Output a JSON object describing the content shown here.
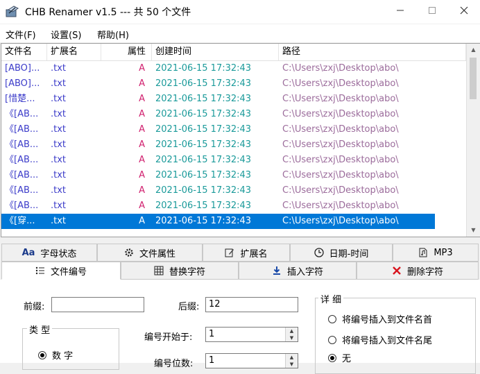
{
  "window": {
    "title": "CHB Renamer v1.5 --- 共 50 个文件"
  },
  "menu": [
    "文件(F)",
    "设置(S)",
    "帮助(H)"
  ],
  "list": {
    "columns": [
      "文件名",
      "扩展名",
      "属性",
      "创建时间",
      "路径"
    ],
    "rows": [
      {
        "name": "[ABO]...",
        "ext": ".txt",
        "attr": "A",
        "time": "2021-06-15 17:32:43",
        "path": "C:\\Users\\zxj\\Desktop\\abo\\"
      },
      {
        "name": "[ABO]...",
        "ext": ".txt",
        "attr": "A",
        "time": "2021-06-15 17:32:43",
        "path": "C:\\Users\\zxj\\Desktop\\abo\\"
      },
      {
        "name": "[惜楚...",
        "ext": ".txt",
        "attr": "A",
        "time": "2021-06-15 17:32:43",
        "path": "C:\\Users\\zxj\\Desktop\\abo\\"
      },
      {
        "name": "《[AB...",
        "ext": ".txt",
        "attr": "A",
        "time": "2021-06-15 17:32:43",
        "path": "C:\\Users\\zxj\\Desktop\\abo\\"
      },
      {
        "name": "《[AB...",
        "ext": ".txt",
        "attr": "A",
        "time": "2021-06-15 17:32:43",
        "path": "C:\\Users\\zxj\\Desktop\\abo\\"
      },
      {
        "name": "《[AB...",
        "ext": ".txt",
        "attr": "A",
        "time": "2021-06-15 17:32:43",
        "path": "C:\\Users\\zxj\\Desktop\\abo\\"
      },
      {
        "name": "《[AB...",
        "ext": ".txt",
        "attr": "A",
        "time": "2021-06-15 17:32:43",
        "path": "C:\\Users\\zxj\\Desktop\\abo\\"
      },
      {
        "name": "《[AB...",
        "ext": ".txt",
        "attr": "A",
        "time": "2021-06-15 17:32:43",
        "path": "C:\\Users\\zxj\\Desktop\\abo\\"
      },
      {
        "name": "《[AB...",
        "ext": ".txt",
        "attr": "A",
        "time": "2021-06-15 17:32:43",
        "path": "C:\\Users\\zxj\\Desktop\\abo\\"
      },
      {
        "name": "《[AB...",
        "ext": ".txt",
        "attr": "A",
        "time": "2021-06-15 17:32:43",
        "path": "C:\\Users\\zxj\\Desktop\\abo\\"
      },
      {
        "name": "《[穿...",
        "ext": ".txt",
        "attr": "A",
        "time": "2021-06-15 17:32:43",
        "path": "C:\\Users\\zxj\\Desktop\\abo\\",
        "selected": true
      }
    ]
  },
  "tabs_top": [
    {
      "label": "字母状态",
      "icon": "aa-icon"
    },
    {
      "label": "文件属性",
      "icon": "gear-icon"
    },
    {
      "label": "扩展名",
      "icon": "edit-icon"
    },
    {
      "label": "日期-时间",
      "icon": "clock-icon"
    },
    {
      "label": "MP3",
      "icon": "music-file-icon"
    }
  ],
  "tabs_bottom": [
    {
      "label": "文件编号",
      "icon": "list-icon",
      "active": true
    },
    {
      "label": "替换字符",
      "icon": "grid-icon"
    },
    {
      "label": "插入字符",
      "icon": "insert-icon"
    },
    {
      "label": "删除字符",
      "icon": "delete-x-icon"
    }
  ],
  "panel": {
    "prefix_label": "前缀:",
    "prefix_value": "",
    "suffix_label": "后缀:",
    "suffix_value": "12",
    "start_label": "编号开始于:",
    "start_value": "1",
    "digits_label": "编号位数:",
    "digits_value": "1",
    "type_group": "类 型",
    "type_options": [
      "数 字"
    ],
    "detail_group": "详 细",
    "detail_options": [
      "将编号插入到文件名首",
      "将编号插入到文件名尾",
      "无"
    ],
    "detail_selected": 2
  },
  "colors": {
    "selection": "#0078d7",
    "name_text": "#3b3bc9",
    "attr_text": "#d01f6e",
    "time_text": "#1a9a9a",
    "path_text": "#9b6b9b"
  }
}
